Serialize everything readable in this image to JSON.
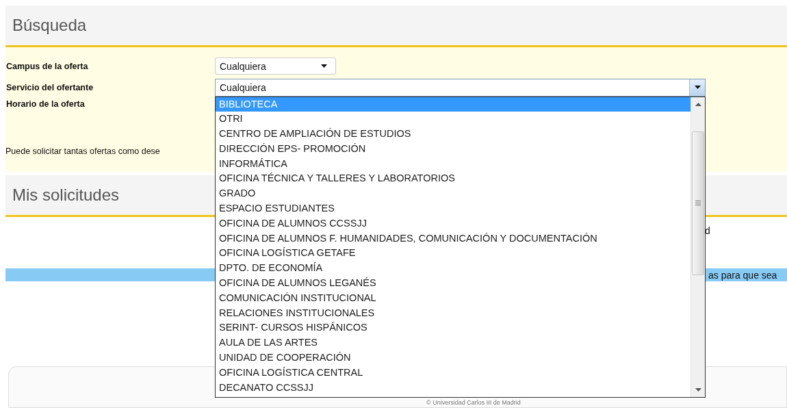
{
  "search": {
    "title": "Búsqueda",
    "fields": [
      {
        "label": "Campus de la oferta",
        "value": "Cualquiera",
        "expanded": false
      },
      {
        "label": "Servicio del ofertante",
        "value": "Cualquiera",
        "expanded": true,
        "options": [
          {
            "label": "BIBLIOTECA",
            "selected": true
          },
          {
            "label": "OTRI",
            "selected": false
          },
          {
            "label": "CENTRO DE AMPLIACIÓN DE ESTUDIOS",
            "selected": false
          },
          {
            "label": "DIRECCIÓN EPS- PROMOCIÓN",
            "selected": false
          },
          {
            "label": "INFORMÁTICA",
            "selected": false
          },
          {
            "label": "OFICINA TÉCNICA Y TALLERES Y LABORATORIOS",
            "selected": false
          },
          {
            "label": "GRADO",
            "selected": false
          },
          {
            "label": "ESPACIO ESTUDIANTES",
            "selected": false
          },
          {
            "label": "OFICINA DE ALUMNOS CCSSJJ",
            "selected": false
          },
          {
            "label": "OFICINA DE ALUMNOS F. HUMANIDADES, COMUNICACIÓN Y DOCUMENTACIÓN",
            "selected": false
          },
          {
            "label": "OFICINA LOGÍSTICA GETAFE",
            "selected": false
          },
          {
            "label": "DPTO. DE ECONOMÍA",
            "selected": false
          },
          {
            "label": "OFICINA DE ALUMNOS LEGANÉS",
            "selected": false
          },
          {
            "label": "COMUNICACIÓN INSTITUCIONAL",
            "selected": false
          },
          {
            "label": "RELACIONES INSTITUCIONALES",
            "selected": false
          },
          {
            "label": "SERINT- CURSOS HISPÁNICOS",
            "selected": false
          },
          {
            "label": "AULA DE LAS ARTES",
            "selected": false
          },
          {
            "label": "UNIDAD DE COOPERACIÓN",
            "selected": false
          },
          {
            "label": "OFICINA LOGÍSTICA CENTRAL",
            "selected": false
          },
          {
            "label": "DECANATO CCSSJJ",
            "selected": false
          }
        ]
      },
      {
        "label": "Horario de la oferta"
      }
    ],
    "note": "Puede solicitar tantas ofertas como dese"
  },
  "requests": {
    "title": "Mis solicitudes",
    "text": "d",
    "banner": "as para que sea"
  },
  "footer": {
    "copyright": "© Universidad Carlos III de Madrid"
  }
}
